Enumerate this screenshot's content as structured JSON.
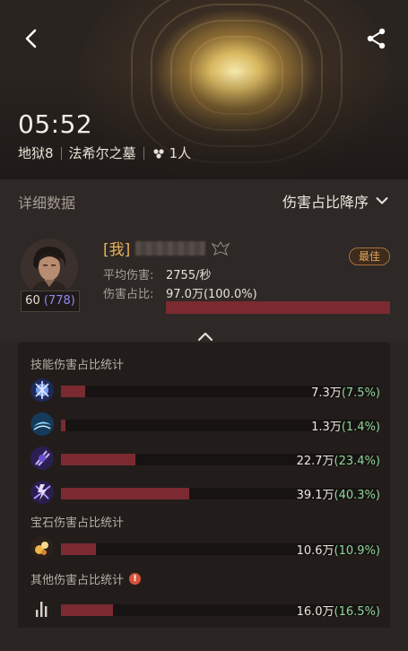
{
  "header": {
    "time": "05:52",
    "difficulty": "地狱8",
    "dungeon": "法希尔之墓",
    "party": "1人"
  },
  "section": {
    "title": "详细数据",
    "sort_label": "伤害占比降序"
  },
  "player": {
    "me_tag": "[我]",
    "level": "60",
    "power": "(778)",
    "badge": "最佳",
    "avg_damage_label": "平均伤害:",
    "avg_damage_value": "2755/秒",
    "share_label": "伤害占比:",
    "share_value": "97.0万(100.0%)",
    "share_fraction": 1.0
  },
  "skills": {
    "title": "技能伤害占比统计",
    "rows": [
      {
        "icon": "skill-lightning-orb-icon",
        "amount": "7.3万",
        "pct": "(7.5%)",
        "fraction": 0.075
      },
      {
        "icon": "skill-frost-wave-icon",
        "amount": "1.3万",
        "pct": "(1.4%)",
        "fraction": 0.014
      },
      {
        "icon": "skill-arcane-slash-icon",
        "amount": "22.7万",
        "pct": "(23.4%)",
        "fraction": 0.234
      },
      {
        "icon": "skill-thunder-burst-icon",
        "amount": "39.1万",
        "pct": "(40.3%)",
        "fraction": 0.403
      }
    ]
  },
  "gems": {
    "title": "宝石伤害占比统计",
    "rows": [
      {
        "icon": "gem-icon",
        "amount": "10.6万",
        "pct": "(10.9%)",
        "fraction": 0.109
      }
    ]
  },
  "other": {
    "title": "其他伤害占比统计",
    "warning": "!",
    "rows": [
      {
        "icon": "bar-stats-icon",
        "amount": "16.0万",
        "pct": "(16.5%)",
        "fraction": 0.165
      }
    ]
  }
}
